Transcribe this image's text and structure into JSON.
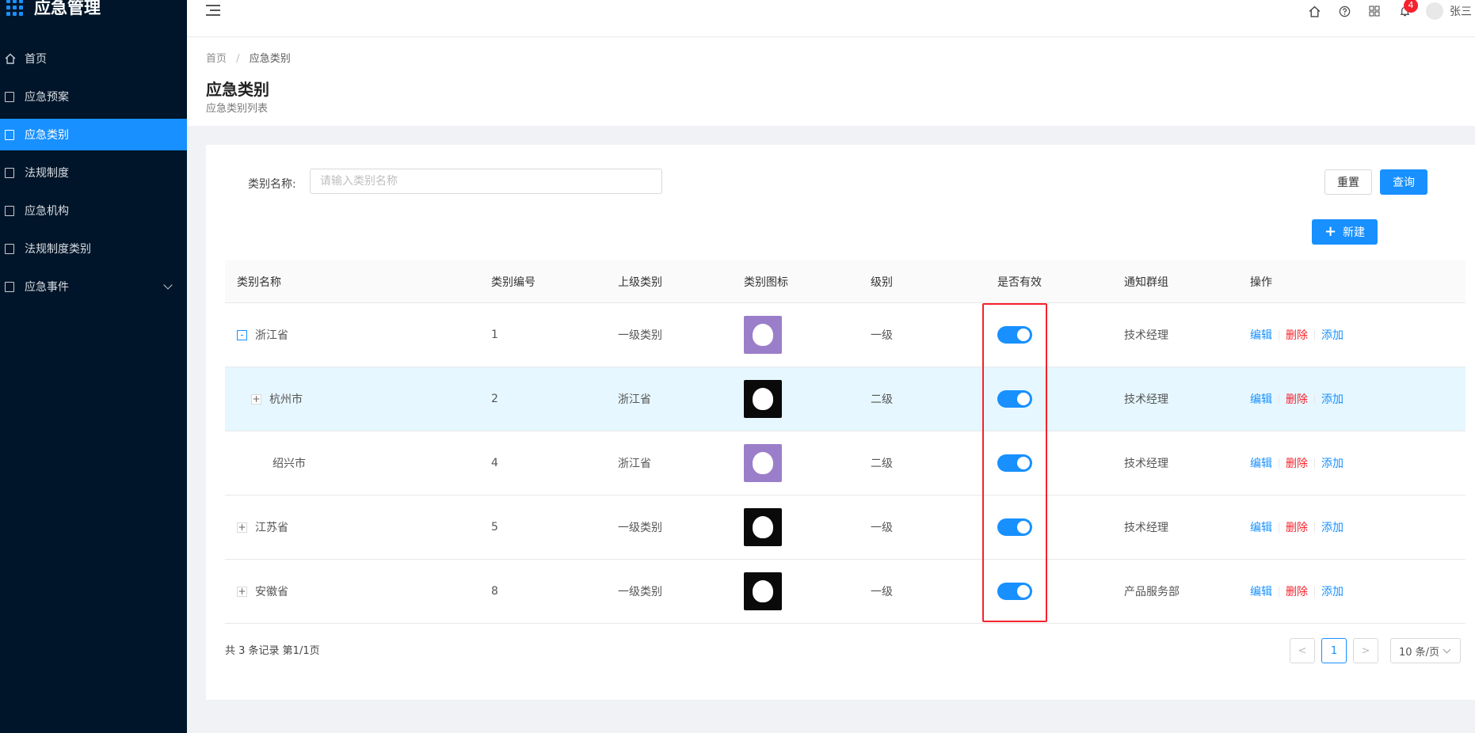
{
  "app": {
    "title": "应急管理"
  },
  "sidebar": {
    "items": [
      {
        "label": "首页"
      },
      {
        "label": "应急预案"
      },
      {
        "label": "应急类别"
      },
      {
        "label": "法规制度"
      },
      {
        "label": "应急机构"
      },
      {
        "label": "法规制度类别"
      },
      {
        "label": "应急事件"
      }
    ]
  },
  "header": {
    "notification_count": "4",
    "user_name": "张三"
  },
  "breadcrumb": {
    "home": "首页",
    "separator": "/",
    "current": "应急类别"
  },
  "page": {
    "title": "应急类别",
    "subtitle": "应急类别列表"
  },
  "search": {
    "label": "类别名称:",
    "placeholder": "请输入类别名称",
    "value": ""
  },
  "buttons": {
    "reset": "重置",
    "query": "查询",
    "new": "新建",
    "new_icon": "+"
  },
  "table": {
    "headers": [
      "类别名称",
      "类别编号",
      "上级类别",
      "类别图标",
      "级别",
      "是否有效",
      "通知群组",
      "操作"
    ],
    "rows": [
      {
        "expander": "-",
        "name": "浙江省",
        "code": "1",
        "parent": "一级类别",
        "icon": "purple-cat-icon",
        "level": "一级",
        "valid": true,
        "group": "技术经理",
        "edit": "编辑",
        "delete": "删除",
        "add": "添加"
      },
      {
        "expander": "+",
        "name": "杭州市",
        "code": "2",
        "parent": "浙江省",
        "icon": "black-cat-icon",
        "level": "二级",
        "valid": true,
        "group": "技术经理",
        "edit": "编辑",
        "delete": "删除",
        "add": "添加"
      },
      {
        "expander": "",
        "name": "绍兴市",
        "code": "4",
        "parent": "浙江省",
        "icon": "purple-cat-icon",
        "level": "二级",
        "valid": true,
        "group": "技术经理",
        "edit": "编辑",
        "delete": "删除",
        "add": "添加"
      },
      {
        "expander": "+",
        "name": "江苏省",
        "code": "5",
        "parent": "一级类别",
        "icon": "black-cat-icon",
        "level": "一级",
        "valid": true,
        "group": "技术经理",
        "edit": "编辑",
        "delete": "删除",
        "add": "添加"
      },
      {
        "expander": "+",
        "name": "安徽省",
        "code": "8",
        "parent": "一级类别",
        "icon": "black-cat-icon",
        "level": "一级",
        "valid": true,
        "group": "产品服务部",
        "edit": "编辑",
        "delete": "删除",
        "add": "添加"
      }
    ]
  },
  "pagination": {
    "summary": "共 3 条记录 第1/1页",
    "current_page": "1",
    "prev": "<",
    "next": ">",
    "page_size": "10 条/页"
  },
  "colors": {
    "sider_bg": "#001529",
    "primary": "#1890ff",
    "danger": "#f5222d",
    "highlight_row": "#e6f7ff"
  }
}
